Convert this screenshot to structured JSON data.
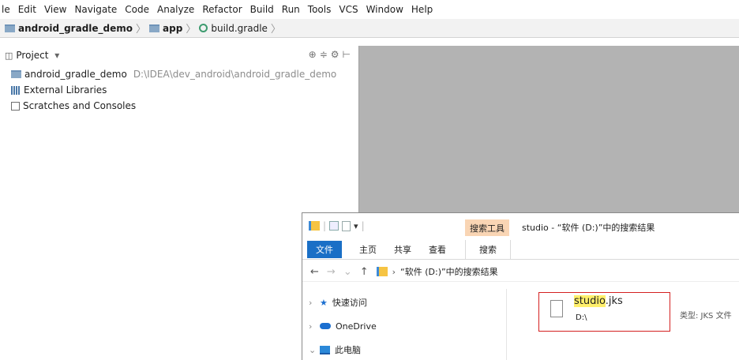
{
  "ide": {
    "menu": [
      "le",
      "Edit",
      "View",
      "Navigate",
      "Code",
      "Analyze",
      "Refactor",
      "Build",
      "Run",
      "Tools",
      "VCS",
      "Window",
      "Help"
    ],
    "breadcrumb": {
      "project": "android_gradle_demo",
      "module": "app",
      "file": "build.gradle"
    },
    "project_panel": {
      "view_label": "Project",
      "dropdown_glyph": "▾",
      "tree": {
        "project_name": "android_gradle_demo",
        "project_path": "D:\\IDEA\\dev_android\\android_gradle_demo",
        "external_libraries": "External Libraries",
        "scratches": "Scratches and Consoles"
      }
    }
  },
  "explorer": {
    "title": "studio - “软件 (D:)”中的搜索结果",
    "contextual_tab": "搜索工具",
    "tabs": {
      "file": "文件",
      "home": "主页",
      "share": "共享",
      "view": "查看",
      "search": "搜索"
    },
    "address": "“软件 (D:)”中的搜索结果",
    "nav": {
      "back": "←",
      "forward": "→",
      "recent": "⌄",
      "up": "↑",
      "chevron": "›"
    },
    "sidebar": [
      {
        "label": "快速访问",
        "icon": "star-icon",
        "chevron": "›"
      },
      {
        "label": "OneDrive",
        "icon": "cloud-icon",
        "chevron": "›"
      },
      {
        "label": "此电脑",
        "icon": "computer-icon",
        "chevron": "⌄"
      }
    ],
    "result": {
      "name_highlight": "studio",
      "name_rest": ".jks",
      "location": "D:\\",
      "type_text": "类型: JKS 文件"
    }
  },
  "colors": {
    "file_tab": "#1a6fc6",
    "search_tools_tab": "#f9d5b4",
    "highlight": "#ffef6b",
    "result_border": "#d42020",
    "editor_bg": "#b3b3b3"
  }
}
